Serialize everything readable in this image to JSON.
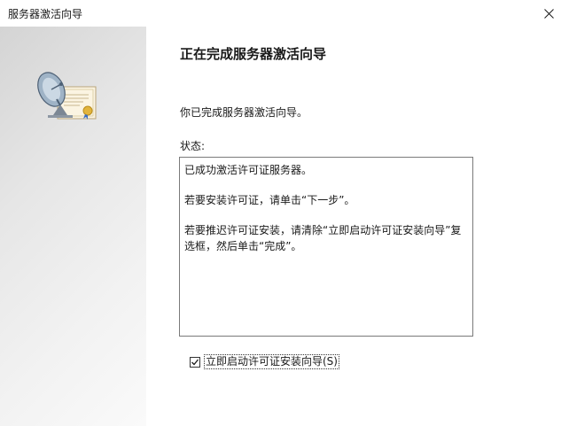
{
  "window": {
    "title": "服务器激活向导",
    "close_icon": "close-icon"
  },
  "sidebar": {
    "icon": "satellite-certificate-icon"
  },
  "main": {
    "heading": "正在完成服务器激活向导",
    "intro": "你已完成服务器激活向导。",
    "status_label": "状态:",
    "status_lines": [
      "已成功激活许可证服务器。",
      "若要安装许可证，请单击“下一步”。",
      "若要推迟许可证安装，请清除“立即启动许可证安装向导”复选框，然后单击“完成”。"
    ],
    "checkbox": {
      "label": "立即启动许可证安装向导(S)",
      "checked": true
    }
  }
}
